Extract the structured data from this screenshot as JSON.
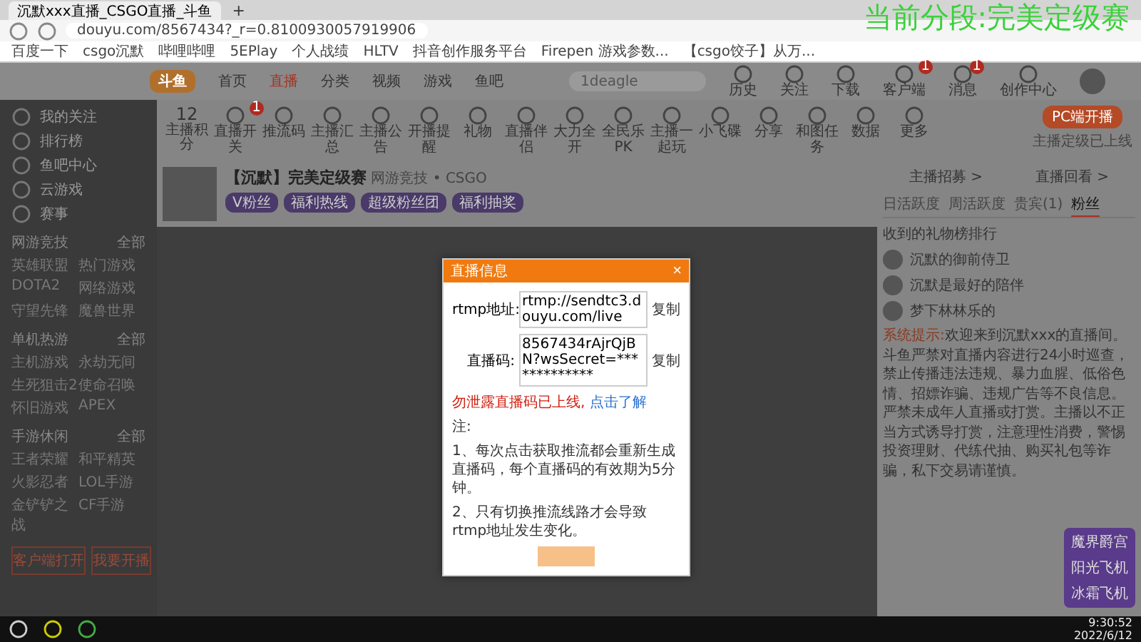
{
  "browser": {
    "tab_title": "沉默xxx直播_CSGO直播_斗鱼",
    "new_tab": "+",
    "url": "douyu.com/8567434?_r=0.8100930057919906",
    "bookmarks": [
      "百度一下",
      "csgo沉默",
      "哔哩哔哩",
      "5EPlay",
      "个人战绩",
      "HLTV",
      "抖音创作服务平台",
      "Firepen 游戏参数...",
      "【csgo饺子】从万..."
    ]
  },
  "overlay_caption": "当前分段:完美定级赛",
  "nav": {
    "logo": "斗鱼",
    "links": [
      {
        "label": "首页",
        "selected": false
      },
      {
        "label": "直播",
        "selected": true
      },
      {
        "label": "分类",
        "selected": false
      },
      {
        "label": "视频",
        "selected": false
      },
      {
        "label": "游戏",
        "selected": false
      },
      {
        "label": "鱼吧",
        "selected": false
      }
    ],
    "search": {
      "placeholder": "1deagle"
    },
    "tools": [
      {
        "label": "历史"
      },
      {
        "label": "关注"
      },
      {
        "label": "下载"
      },
      {
        "label": "客户端",
        "badge": "1"
      },
      {
        "label": "消息",
        "badge": "1"
      },
      {
        "label": "创作中心"
      }
    ]
  },
  "sidebar": {
    "items": [
      "我的关注",
      "排行榜",
      "鱼吧中心",
      "云游戏",
      "赛事"
    ],
    "sections": [
      {
        "title": "网游竞技",
        "more": "全部",
        "games": [
          "英雄联盟",
          "热门游戏",
          "DOTA2",
          "网络游戏",
          "守望先锋",
          "魔兽世界"
        ]
      },
      {
        "title": "单机热游",
        "more": "全部",
        "games": [
          "主机游戏",
          "永劫无间",
          "生死狙击2",
          "使命召唤",
          "怀旧游戏",
          "APEX"
        ]
      },
      {
        "title": "手游休闲",
        "more": "全部",
        "games": [
          "王者荣耀",
          "和平精英",
          "火影忍者",
          "LOL手游",
          "金铲铲之战",
          "CF手游"
        ]
      }
    ],
    "buttons": [
      "客户端打开",
      "我要开播"
    ]
  },
  "toolbar": {
    "score": "12",
    "score_label": "主播积分",
    "items": [
      {
        "label": "直播开关",
        "badge": "1"
      },
      {
        "label": "推流码"
      },
      {
        "label": "主播汇总"
      },
      {
        "label": "主播公告"
      },
      {
        "label": "开播提醒"
      },
      {
        "label": "礼物"
      },
      {
        "label": "直播伴侣"
      },
      {
        "label": "大力全开"
      },
      {
        "label": "全民乐PK"
      },
      {
        "label": "主播一起玩"
      },
      {
        "label": "小飞碟"
      },
      {
        "label": "分享"
      },
      {
        "label": "和图任务"
      },
      {
        "label": "数据"
      },
      {
        "label": "更多"
      }
    ],
    "pc_button": "PC端开播",
    "pc_note": "主播定级已上线"
  },
  "room": {
    "title": "【沉默】完美定级赛",
    "category": "网游竞技 • CSGO",
    "tags": [
      "V粉丝",
      "福利热线",
      "超级粉丝团",
      "福利抽奖"
    ]
  },
  "dialog": {
    "title": "直播信息",
    "close": "×",
    "fields": [
      {
        "label": "rtmp地址:",
        "value": "rtmp://sendtc3.douyu.com/live",
        "copy": "复制"
      },
      {
        "label": "直播码:",
        "value": "8567434rAjrQjBN?wsSecret=*************",
        "copy": "复制"
      }
    ],
    "warning": "勿泄露直播码已上线,",
    "learn_more": "点击了解",
    "notes": [
      "注:",
      "1、每次点击获取推流都会重新生成直播码，每个直播码的有效期为5分钟。",
      "2、只有切换推流线路才会导致rtmp地址发生变化。"
    ]
  },
  "right": {
    "links": [
      "主播招募 >",
      "直播回看 >"
    ],
    "tabs": [
      {
        "label": "日活跃度",
        "selected": false
      },
      {
        "label": "周活跃度",
        "selected": false
      },
      {
        "label": "贵宾(1)",
        "selected": false
      },
      {
        "label": "粉丝",
        "selected": true
      }
    ],
    "rank_title": "收到的礼物榜排行",
    "rank": [
      {
        "name": "沉默的御前侍卫"
      },
      {
        "name": "沉默是最好的陪伴"
      },
      {
        "name": "梦下林林乐的"
      }
    ],
    "promo": {
      "title": "魔界爵宫",
      "items": [
        "阳光飞机",
        "冰霜飞机"
      ]
    },
    "notice_label": "系统提示:",
    "notice": "欢迎来到沉默xxx的直播间。斗鱼严禁对直播内容进行24小时巡查，禁止传播违法违规、暴力血腥、低俗色情、招嫖诈骗、违规广告等不良信息。严禁未成年人直播或打赏。主播以不正当方式诱导打赏，注意理性消费，警惕投资理财、代练代抽、购买礼包等诈骗，私下交易请谨慎。"
  },
  "taskbar": {
    "time": "9:30:52",
    "date": "2022/6/12"
  }
}
